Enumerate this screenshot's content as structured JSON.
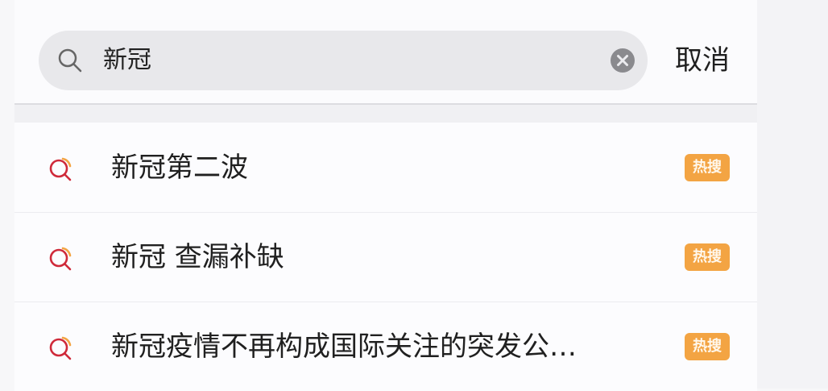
{
  "search": {
    "value": "新冠",
    "placeholder": ""
  },
  "header": {
    "cancel_label": "取消"
  },
  "icons": {
    "search": "search-icon",
    "clear": "clear-icon",
    "suggestion": "hot-search-icon"
  },
  "suggestions": [
    {
      "label": "新冠第二波",
      "badge": "热搜"
    },
    {
      "label": "新冠 查漏补缺",
      "badge": "热搜"
    },
    {
      "label": "新冠疫情不再构成国际关注的突发公…",
      "badge": "热搜"
    }
  ],
  "colors": {
    "badge": "#f3a443",
    "search_box": "#e8e8eb",
    "suggest_icon_red": "#cf2a3a",
    "suggest_icon_orange": "#f3a443"
  }
}
